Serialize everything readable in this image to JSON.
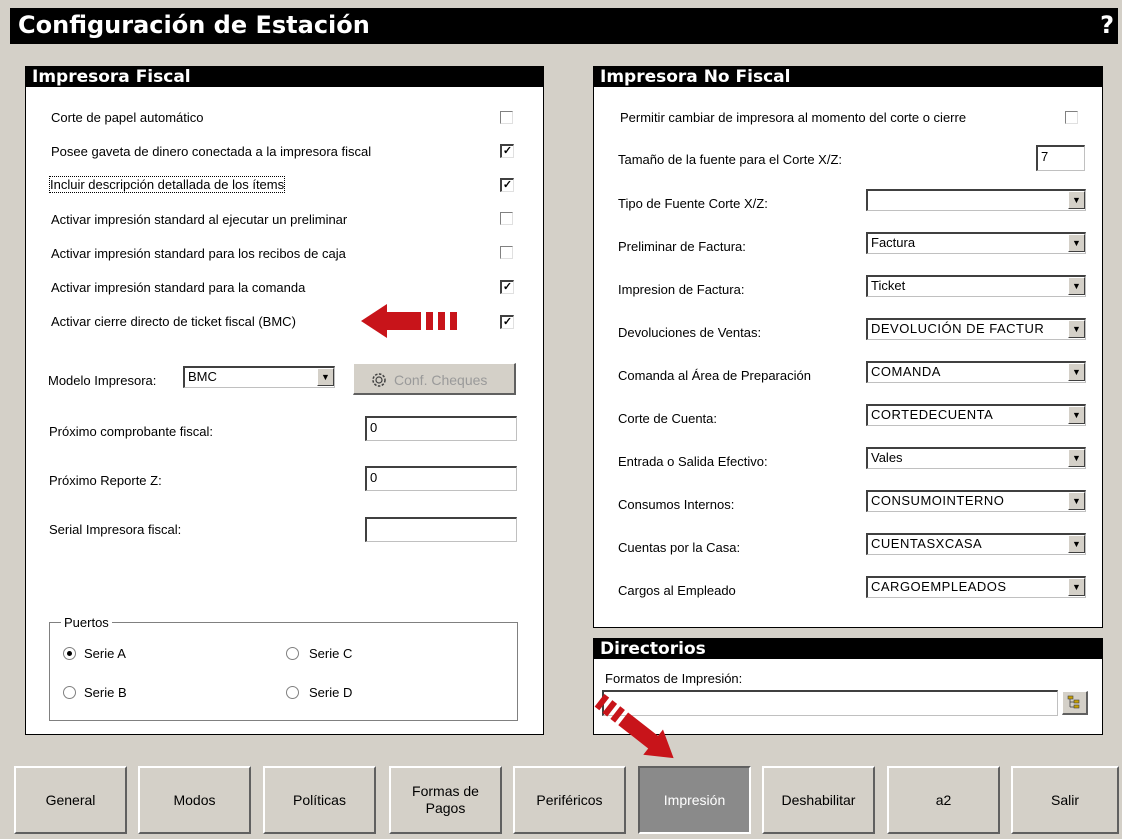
{
  "window": {
    "title": "Configuración de Estación",
    "help": "?"
  },
  "fiscal": {
    "header": "Impresora Fiscal",
    "options": [
      {
        "label": "Corte de papel automático",
        "checked": false
      },
      {
        "label": "Posee gaveta de dinero conectada a la impresora fiscal",
        "checked": true
      },
      {
        "label": "Incluir descripción detallada de los ítems",
        "checked": true
      },
      {
        "label": "Activar impresión standard al ejecutar un preliminar",
        "checked": false
      },
      {
        "label": "Activar impresión standard para los recibos de caja",
        "checked": false
      },
      {
        "label": "Activar impresión standard para la comanda",
        "checked": true
      },
      {
        "label": "Activar cierre directo de ticket fiscal (BMC)",
        "checked": true
      }
    ],
    "model_label": "Modelo Impresora:",
    "model_value": "BMC",
    "conf_cheques": "Conf. Cheques",
    "next_fiscal_label": "Próximo comprobante fiscal:",
    "next_fiscal_value": "0",
    "next_z_label": "Próximo Reporte Z:",
    "next_z_value": "0",
    "serial_label": "Serial Impresora fiscal:",
    "serial_value": "",
    "ports": {
      "legend": "Puertos",
      "a": "Serie A",
      "b": "Serie B",
      "c": "Serie C",
      "d": "Serie D",
      "selected": "Serie A"
    }
  },
  "nonfiscal": {
    "header": "Impresora No Fiscal",
    "allow_change_label": "Permitir cambiar de impresora al momento del corte o cierre",
    "allow_change_checked": false,
    "font_size_label": "Tamaño de la fuente para el Corte X/Z:",
    "font_size_value": "7",
    "rows": [
      {
        "label": "Tipo de Fuente Corte X/Z:",
        "value": ""
      },
      {
        "label": "Preliminar de Factura:",
        "value": "Factura"
      },
      {
        "label": "Impresion de Factura:",
        "value": "Ticket"
      },
      {
        "label": "Devoluciones de Ventas:",
        "value": "DEVOLUCIÓN DE FACTUR"
      },
      {
        "label": "Comanda al Área de Preparación",
        "value": "COMANDA"
      },
      {
        "label": "Corte de Cuenta:",
        "value": "CORTEDECUENTA"
      },
      {
        "label": "Entrada o Salida Efectivo:",
        "value": "Vales"
      },
      {
        "label": "Consumos Internos:",
        "value": "CONSUMOINTERNO"
      },
      {
        "label": "Cuentas por la Casa:",
        "value": "CUENTASXCASA"
      },
      {
        "label": "Cargos al Empleado",
        "value": "CARGOEMPLEADOS"
      }
    ]
  },
  "directories": {
    "header": "Directorios",
    "formats_label": "Formatos de Impresión:",
    "formats_value": ""
  },
  "tabs": [
    {
      "label": "General"
    },
    {
      "label": "Modos"
    },
    {
      "label": "Políticas"
    },
    {
      "label": "Formas de Pagos"
    },
    {
      "label": "Periféricos"
    },
    {
      "label": "Impresión",
      "active": true
    },
    {
      "label": "Deshabilitar"
    },
    {
      "label": "a2"
    },
    {
      "label": "Salir"
    }
  ],
  "colors": {
    "arrow": "#c8141a",
    "title_bg": "#000000",
    "window_bg": "#d4d0c8"
  }
}
